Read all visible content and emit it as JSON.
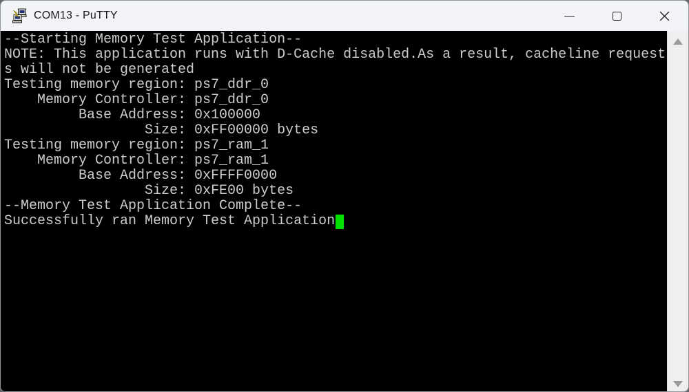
{
  "window": {
    "title": "COM13 - PuTTY",
    "titlebar_bg": "#f2f4f7",
    "app_icon": "putty-app-icon",
    "controls": {
      "minimize_label": "Minimize",
      "maximize_label": "Maximize",
      "close_label": "Close"
    }
  },
  "terminal": {
    "background": "#000000",
    "foreground": "#cccccc",
    "columns": 80,
    "lines": [
      "--Starting Memory Test Application--",
      "NOTE: This application runs with D-Cache disabled.As a result, cacheline request",
      "s will not be generated",
      "Testing memory region: ps7_ddr_0",
      "    Memory Controller: ps7_ddr_0",
      "         Base Address: 0x100000",
      "                 Size: 0xFF00000 bytes",
      "Testing memory region: ps7_ram_1",
      "    Memory Controller: ps7_ram_1",
      "         Base Address: 0xFFFF0000",
      "                 Size: 0xFE00 bytes",
      "--Memory Test Application Complete--",
      "Successfully ran Memory Test Application"
    ],
    "cursor": {
      "visible": true,
      "style": "block",
      "color": "#00e000",
      "after_last_line": true
    }
  },
  "scrollbar": {
    "track_color": "#efefef",
    "arrow_color": "#9b9b9b",
    "up_icon": "scroll-up-arrow-icon",
    "down_icon": "scroll-down-arrow-icon"
  }
}
